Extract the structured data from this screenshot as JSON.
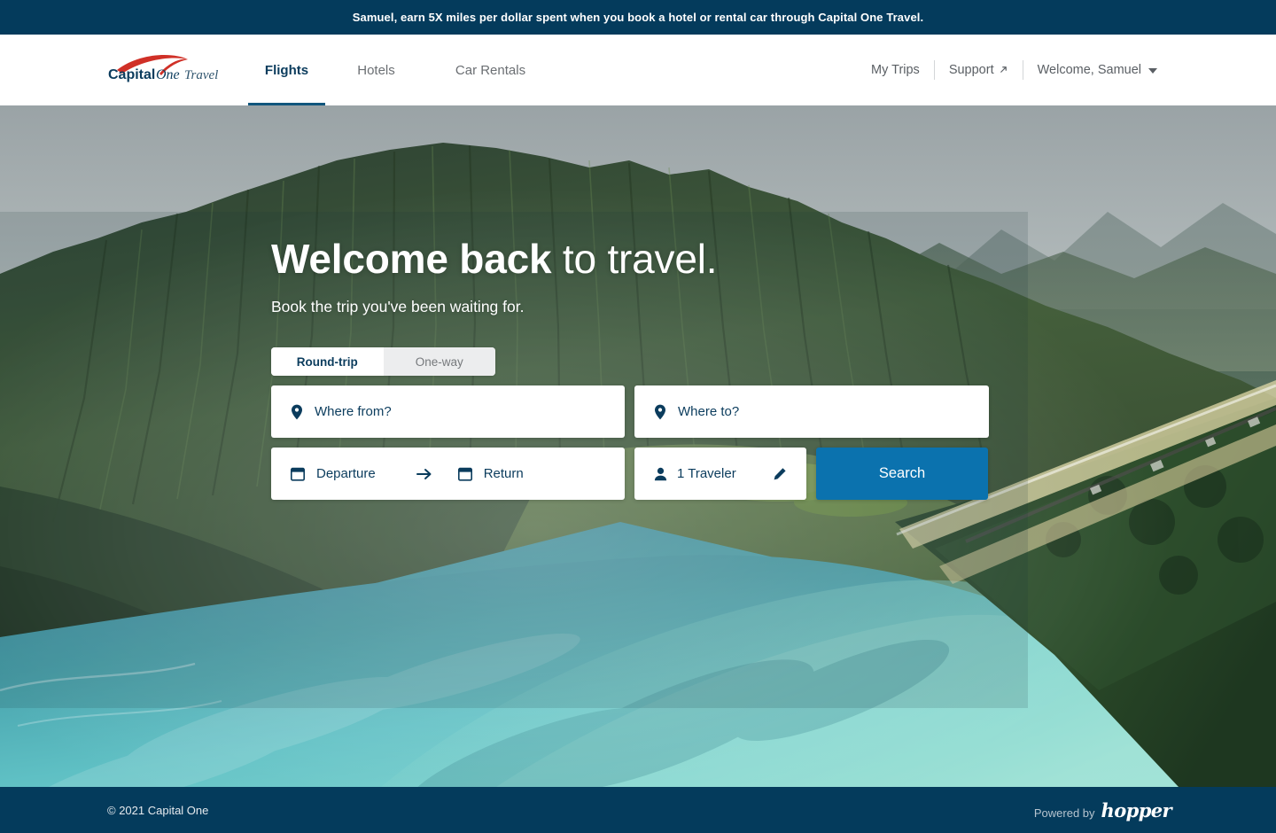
{
  "promo": {
    "text": "Samuel, earn 5X miles per dollar spent when you book a hotel or rental car through Capital One Travel."
  },
  "header": {
    "logo": {
      "capital": "Capital",
      "one": "One",
      "travel": "Travel"
    },
    "nav": [
      {
        "label": "Flights",
        "active": true
      },
      {
        "label": "Hotels",
        "active": false
      },
      {
        "label": "Car Rentals",
        "active": false
      }
    ],
    "account": {
      "my_trips": "My Trips",
      "support": "Support",
      "support_icon": "external-link-arrow-icon",
      "welcome": "Welcome, Samuel",
      "caret_icon": "chevron-down-icon"
    }
  },
  "hero": {
    "title_bold": "Welcome back",
    "title_light": " to travel.",
    "subtitle": "Book the trip you've been waiting for."
  },
  "search": {
    "trip_types": [
      {
        "label": "Round-trip",
        "selected": true
      },
      {
        "label": "One-way",
        "selected": false
      }
    ],
    "origin": {
      "placeholder": "Where from?",
      "icon": "location-pin-icon",
      "value": ""
    },
    "destination": {
      "placeholder": "Where to?",
      "icon": "location-pin-icon",
      "value": ""
    },
    "departure": {
      "placeholder": "Departure",
      "icon": "calendar-icon",
      "value": ""
    },
    "return": {
      "placeholder": "Return",
      "icon": "calendar-icon",
      "value": ""
    },
    "date_separator_icon": "arrow-right-icon",
    "travelers": {
      "label": "1 Traveler",
      "icon": "person-icon",
      "edit_icon": "pencil-icon"
    },
    "search_button": "Search"
  },
  "footer": {
    "copyright": "© 2021 Capital One",
    "powered_by": "Powered by",
    "partner": "hopper"
  },
  "colors": {
    "banner_navy": "#043b5c",
    "brand_navy": "#0b3c5d",
    "accent_blue": "#0b72ae",
    "logo_red": "#d03027",
    "nav_gray": "#6b6f73"
  }
}
